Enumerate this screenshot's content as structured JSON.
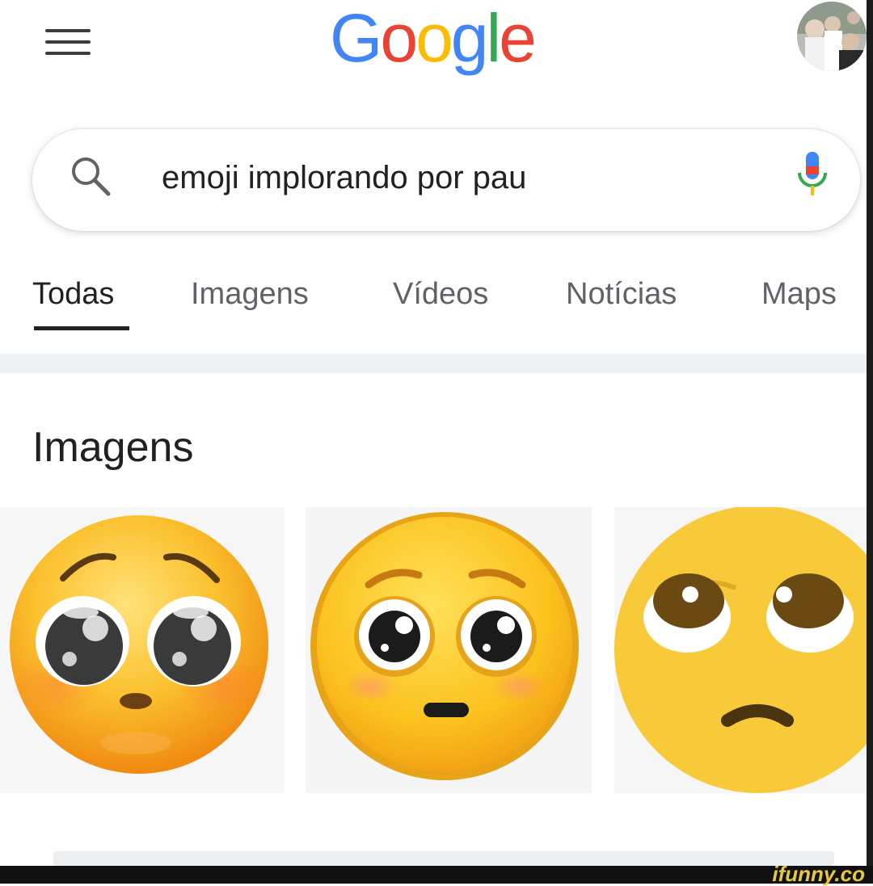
{
  "header": {
    "logo": [
      "G",
      "o",
      "o",
      "g",
      "l",
      "e"
    ],
    "logo_colors": [
      "#4285F4",
      "#EA4335",
      "#FBBC05",
      "#4285F4",
      "#34A853",
      "#EA4335"
    ],
    "menu_icon": "hamburger-menu-icon",
    "avatar_icon": "profile-avatar"
  },
  "search": {
    "query": "emoji implorando por pau",
    "search_icon": "search-icon",
    "mic_icon": "microphone-icon"
  },
  "tabs": [
    {
      "label": "Todas",
      "active": true
    },
    {
      "label": "Imagens",
      "active": false
    },
    {
      "label": "Vídeos",
      "active": false
    },
    {
      "label": "Notícias",
      "active": false
    },
    {
      "label": "Maps",
      "active": false
    }
  ],
  "images_section": {
    "title": "Imagens",
    "results": [
      {
        "name": "pleading-face-emoji-glossy"
      },
      {
        "name": "pleading-face-emoji-flat"
      },
      {
        "name": "pleading-face-emoji-cropped"
      }
    ]
  },
  "watermark": "ifunny.co",
  "colors": {
    "text": "#202124",
    "muted": "#5f6368",
    "emoji_yellow": "#f7c531",
    "emoji_orange": "#f2a11e"
  }
}
